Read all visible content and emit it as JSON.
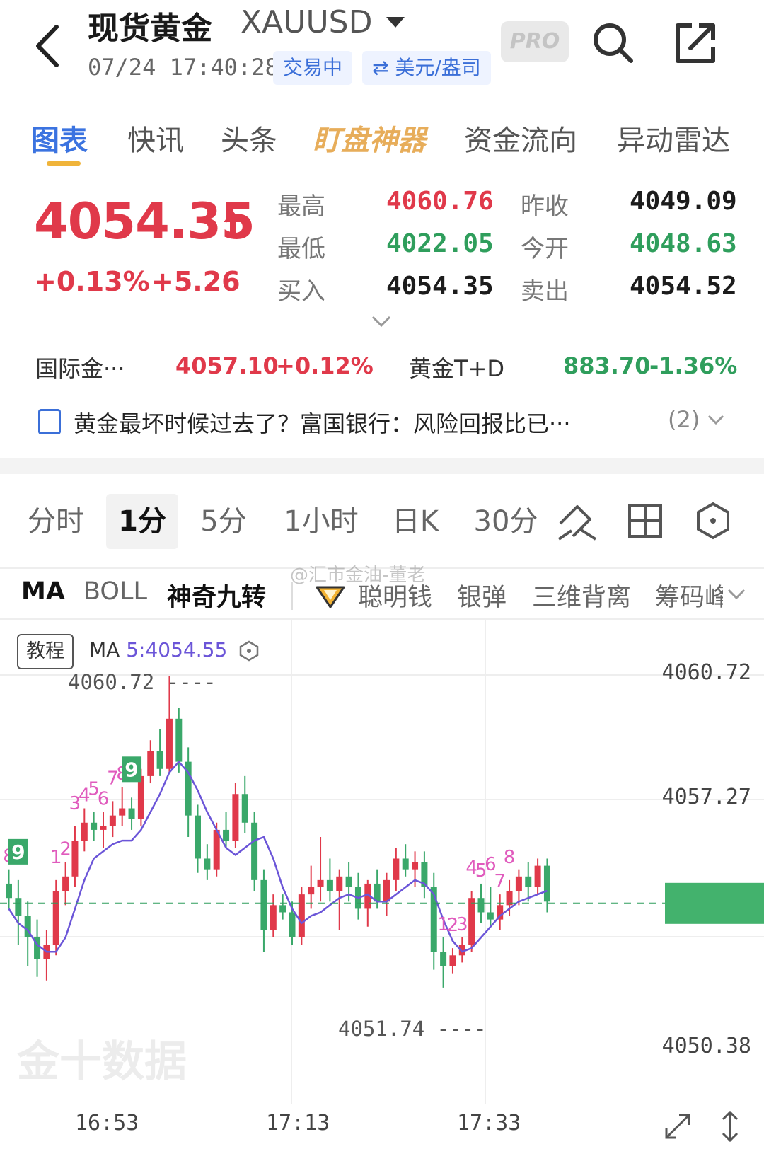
{
  "header": {
    "title": "现货黄金",
    "code": "XAUUSD",
    "timestamp": "07/24 17:40:28",
    "status": "交易中",
    "unit": "⇄ 美元/盎司",
    "pro": "PRO"
  },
  "tabs": [
    {
      "label": "图表",
      "active": true
    },
    {
      "label": "快讯"
    },
    {
      "label": "头条"
    },
    {
      "label": "盯盘神器",
      "special": true
    },
    {
      "label": "资金流向"
    },
    {
      "label": "异动雷达"
    }
  ],
  "quote": {
    "price": "4054.35",
    "change_pct": "+0.13%",
    "change_abs": "+5.26",
    "high_label": "最高",
    "high": "4060.76",
    "low_label": "最低",
    "low": "4022.05",
    "bid_label": "买入",
    "bid": "4054.35",
    "prev_close_label": "昨收",
    "prev_close": "4049.09",
    "open_label": "今开",
    "open": "4048.63",
    "ask_label": "卖出",
    "ask": "4054.52"
  },
  "related": {
    "item1_name": "国际金···",
    "item1_price": "4057.10",
    "item1_pct": "+0.12%",
    "item2_name": "黄金T+D",
    "item2_price": "883.70",
    "item2_pct": "-1.36%"
  },
  "news": {
    "headline": "黄金最坏时候过去了？富国银行：风险回报比已···",
    "count": "(2)"
  },
  "intervals": [
    {
      "label": "分时"
    },
    {
      "label": "1分",
      "active": true
    },
    {
      "label": "5分"
    },
    {
      "label": "1小时"
    },
    {
      "label": "日K"
    },
    {
      "label": "30分"
    }
  ],
  "indicators": {
    "ma": "MA",
    "boll": "BOLL",
    "td9": "神奇九转",
    "smart": "聪明钱",
    "silver": "银弹",
    "div3d": "三维背离",
    "chips": "筹码峰"
  },
  "watermark": "@汇市金油-董老",
  "chart_meta": {
    "tutorial": "教程",
    "ma_prefix": "MA ",
    "ma_value": "5:4054.55",
    "logo": "金十数据"
  },
  "chart_data": {
    "type": "candlestick",
    "y_ticks": [
      "4060.72",
      "4057.27",
      "4050.38"
    ],
    "ylim": [
      4050.38,
      4060.72
    ],
    "x_ticks": [
      "16:53",
      "17:13",
      "17:33"
    ],
    "max_label": "4060.72 ----",
    "min_label": "4051.74 ----",
    "last_price": 4054.35,
    "colors": {
      "up": "#e0394a",
      "down": "#3aa86a",
      "ma": "#6b55d8",
      "price_line": "#2f9e5c"
    },
    "ma_series": [
      4054.2,
      4053.8,
      4053.6,
      4053.2,
      4053.0,
      4053.0,
      4053.4,
      4054.2,
      4055.0,
      4055.6,
      4055.8,
      4056.0,
      4056.1,
      4056.1,
      4056.4,
      4056.9,
      4057.4,
      4058.0,
      4058.3,
      4058.0,
      4057.5,
      4056.9,
      4056.4,
      4055.9,
      4055.7,
      4055.9,
      4056.1,
      4056.2,
      4055.6,
      4054.8,
      4054.2,
      4053.8,
      4054.0,
      4054.1,
      4054.3,
      4054.5,
      4054.6,
      4054.5,
      4054.6,
      4054.4,
      4054.4,
      4054.6,
      4054.8,
      4055.0,
      4054.9,
      4054.6,
      4053.9,
      4053.3,
      4053.0,
      4053.1,
      4053.4,
      4053.7,
      4054.0,
      4054.2,
      4054.4,
      4054.5,
      4054.6,
      4054.7
    ],
    "candles": [
      {
        "o": 4054.9,
        "h": 4055.3,
        "l": 4054.2,
        "c": 4054.5
      },
      {
        "o": 4054.5,
        "h": 4055.0,
        "l": 4053.2,
        "c": 4054.0
      },
      {
        "o": 4054.0,
        "h": 4054.4,
        "l": 4052.6,
        "c": 4053.4
      },
      {
        "o": 4053.4,
        "h": 4053.9,
        "l": 4052.3,
        "c": 4052.8
      },
      {
        "o": 4052.8,
        "h": 4053.6,
        "l": 4052.2,
        "c": 4053.2
      },
      {
        "o": 4053.2,
        "h": 4055.0,
        "l": 4052.9,
        "c": 4054.7
      },
      {
        "o": 4054.7,
        "h": 4055.5,
        "l": 4054.3,
        "c": 4055.1
      },
      {
        "o": 4055.1,
        "h": 4056.5,
        "l": 4054.8,
        "c": 4056.1
      },
      {
        "o": 4056.1,
        "h": 4057.0,
        "l": 4055.8,
        "c": 4056.6
      },
      {
        "o": 4056.6,
        "h": 4056.9,
        "l": 4056.1,
        "c": 4056.4
      },
      {
        "o": 4056.4,
        "h": 4056.9,
        "l": 4055.9,
        "c": 4056.5
      },
      {
        "o": 4056.5,
        "h": 4057.2,
        "l": 4056.2,
        "c": 4056.8
      },
      {
        "o": 4056.8,
        "h": 4057.6,
        "l": 4056.5,
        "c": 4057.0
      },
      {
        "o": 4057.0,
        "h": 4057.3,
        "l": 4056.4,
        "c": 4056.7
      },
      {
        "o": 4056.7,
        "h": 4058.1,
        "l": 4056.5,
        "c": 4057.9
      },
      {
        "o": 4057.9,
        "h": 4058.9,
        "l": 4057.7,
        "c": 4058.6
      },
      {
        "o": 4058.6,
        "h": 4059.2,
        "l": 4057.9,
        "c": 4058.1
      },
      {
        "o": 4058.1,
        "h": 4060.7,
        "l": 4058.0,
        "c": 4059.5
      },
      {
        "o": 4059.5,
        "h": 4059.8,
        "l": 4058.0,
        "c": 4058.3
      },
      {
        "o": 4058.3,
        "h": 4058.7,
        "l": 4056.2,
        "c": 4056.8
      },
      {
        "o": 4056.8,
        "h": 4057.1,
        "l": 4055.2,
        "c": 4055.6
      },
      {
        "o": 4055.6,
        "h": 4056.0,
        "l": 4055.0,
        "c": 4055.3
      },
      {
        "o": 4055.3,
        "h": 4056.6,
        "l": 4055.1,
        "c": 4056.4
      },
      {
        "o": 4056.4,
        "h": 4056.9,
        "l": 4055.9,
        "c": 4056.1
      },
      {
        "o": 4056.1,
        "h": 4057.7,
        "l": 4055.9,
        "c": 4057.4
      },
      {
        "o": 4057.4,
        "h": 4057.9,
        "l": 4056.3,
        "c": 4056.6
      },
      {
        "o": 4056.6,
        "h": 4056.9,
        "l": 4054.7,
        "c": 4055.0
      },
      {
        "o": 4055.0,
        "h": 4055.3,
        "l": 4053.0,
        "c": 4053.6
      },
      {
        "o": 4053.6,
        "h": 4054.6,
        "l": 4053.4,
        "c": 4054.3
      },
      {
        "o": 4054.3,
        "h": 4054.6,
        "l": 4053.9,
        "c": 4054.1
      },
      {
        "o": 4054.1,
        "h": 4054.4,
        "l": 4053.2,
        "c": 4053.4
      },
      {
        "o": 4053.4,
        "h": 4054.8,
        "l": 4053.2,
        "c": 4054.6
      },
      {
        "o": 4054.6,
        "h": 4055.4,
        "l": 4054.2,
        "c": 4054.8
      },
      {
        "o": 4054.8,
        "h": 4056.2,
        "l": 4054.4,
        "c": 4055.0
      },
      {
        "o": 4055.0,
        "h": 4055.6,
        "l": 4054.4,
        "c": 4054.7
      },
      {
        "o": 4054.7,
        "h": 4055.3,
        "l": 4053.6,
        "c": 4055.1
      },
      {
        "o": 4055.1,
        "h": 4055.5,
        "l": 4054.4,
        "c": 4054.8
      },
      {
        "o": 4054.8,
        "h": 4055.2,
        "l": 4053.9,
        "c": 4054.2
      },
      {
        "o": 4054.2,
        "h": 4055.0,
        "l": 4053.7,
        "c": 4054.9
      },
      {
        "o": 4054.9,
        "h": 4055.3,
        "l": 4054.2,
        "c": 4054.4
      },
      {
        "o": 4054.4,
        "h": 4055.2,
        "l": 4054.0,
        "c": 4055.0
      },
      {
        "o": 4055.0,
        "h": 4055.9,
        "l": 4054.7,
        "c": 4055.6
      },
      {
        "o": 4055.6,
        "h": 4056.0,
        "l": 4055.1,
        "c": 4055.3
      },
      {
        "o": 4055.3,
        "h": 4055.8,
        "l": 4054.8,
        "c": 4055.5
      },
      {
        "o": 4055.5,
        "h": 4055.8,
        "l": 4054.5,
        "c": 4054.8
      },
      {
        "o": 4054.8,
        "h": 4055.2,
        "l": 4052.5,
        "c": 4053.0
      },
      {
        "o": 4053.0,
        "h": 4053.4,
        "l": 4052.0,
        "c": 4052.6
      },
      {
        "o": 4052.6,
        "h": 4053.1,
        "l": 4052.4,
        "c": 4052.9
      },
      {
        "o": 4052.9,
        "h": 4053.4,
        "l": 4052.7,
        "c": 4053.2
      },
      {
        "o": 4053.2,
        "h": 4054.7,
        "l": 4053.0,
        "c": 4054.5
      },
      {
        "o": 4054.5,
        "h": 4054.9,
        "l": 4053.8,
        "c": 4054.1
      },
      {
        "o": 4054.1,
        "h": 4054.8,
        "l": 4053.7,
        "c": 4053.9
      },
      {
        "o": 4053.9,
        "h": 4054.6,
        "l": 4053.6,
        "c": 4054.3
      },
      {
        "o": 4054.3,
        "h": 4055.0,
        "l": 4054.0,
        "c": 4054.7
      },
      {
        "o": 4054.7,
        "h": 4055.3,
        "l": 4054.3,
        "c": 4055.1
      },
      {
        "o": 4055.1,
        "h": 4055.5,
        "l": 4054.4,
        "c": 4054.8
      },
      {
        "o": 4054.8,
        "h": 4055.6,
        "l": 4054.6,
        "c": 4055.4
      },
      {
        "o": 4055.4,
        "h": 4055.6,
        "l": 4054.1,
        "c": 4054.4
      }
    ],
    "td_labels": [
      {
        "i": 0,
        "t": "8"
      },
      {
        "i": 1,
        "t": "9",
        "box": true
      },
      {
        "i": 5,
        "t": "1"
      },
      {
        "i": 6,
        "t": "2"
      },
      {
        "i": 7,
        "t": "3"
      },
      {
        "i": 8,
        "t": "4"
      },
      {
        "i": 9,
        "t": "5"
      },
      {
        "i": 10,
        "t": "6"
      },
      {
        "i": 11,
        "t": "7"
      },
      {
        "i": 12,
        "t": "8"
      },
      {
        "i": 13,
        "t": "9",
        "box": true
      },
      {
        "i": 46,
        "t": "1"
      },
      {
        "i": 47,
        "t": "2"
      },
      {
        "i": 48,
        "t": "3"
      },
      {
        "i": 49,
        "t": "4"
      },
      {
        "i": 50,
        "t": "5"
      },
      {
        "i": 51,
        "t": "6"
      },
      {
        "i": 52,
        "t": "7"
      },
      {
        "i": 53,
        "t": "8"
      }
    ]
  }
}
